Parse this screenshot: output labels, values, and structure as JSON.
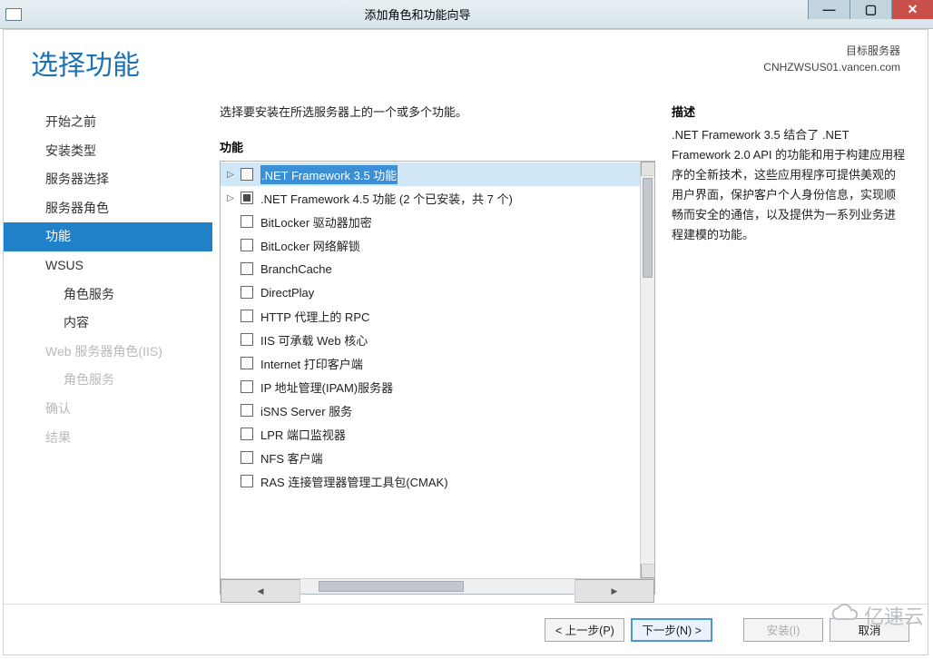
{
  "window": {
    "title": "添加角色和功能向导"
  },
  "header": {
    "title": "选择功能",
    "target_label": "目标服务器",
    "target_server": "CNHZWSUS01.vancen.com"
  },
  "sidebar": {
    "items": [
      {
        "label": "开始之前",
        "state": "normal"
      },
      {
        "label": "安装类型",
        "state": "normal"
      },
      {
        "label": "服务器选择",
        "state": "normal"
      },
      {
        "label": "服务器角色",
        "state": "normal"
      },
      {
        "label": "功能",
        "state": "selected"
      },
      {
        "label": "WSUS",
        "state": "normal"
      },
      {
        "label": "角色服务",
        "state": "normal",
        "indent": true
      },
      {
        "label": "内容",
        "state": "normal",
        "indent": true
      },
      {
        "label": "Web 服务器角色(IIS)",
        "state": "disabled"
      },
      {
        "label": "角色服务",
        "state": "disabled",
        "indent": true
      },
      {
        "label": "确认",
        "state": "disabled"
      },
      {
        "label": "结果",
        "state": "disabled"
      }
    ]
  },
  "main": {
    "instruction": "选择要安装在所选服务器上的一个或多个功能。",
    "features_label": "功能",
    "items": [
      {
        "expander": "right",
        "check": "unchecked",
        "label": ".NET Framework 3.5 功能",
        "selected": true
      },
      {
        "expander": "right",
        "check": "partial",
        "label": ".NET Framework 4.5 功能 (2 个已安装，共 7 个)"
      },
      {
        "expander": "none",
        "check": "unchecked",
        "label": "BitLocker 驱动器加密"
      },
      {
        "expander": "none",
        "check": "unchecked",
        "label": "BitLocker 网络解锁"
      },
      {
        "expander": "none",
        "check": "unchecked",
        "label": "BranchCache"
      },
      {
        "expander": "none",
        "check": "unchecked",
        "label": "DirectPlay"
      },
      {
        "expander": "none",
        "check": "unchecked",
        "label": "HTTP 代理上的 RPC"
      },
      {
        "expander": "none",
        "check": "unchecked",
        "label": "IIS 可承载 Web 核心"
      },
      {
        "expander": "none",
        "check": "unchecked",
        "label": "Internet 打印客户端"
      },
      {
        "expander": "none",
        "check": "unchecked",
        "label": "IP 地址管理(IPAM)服务器"
      },
      {
        "expander": "none",
        "check": "unchecked",
        "label": "iSNS Server 服务"
      },
      {
        "expander": "none",
        "check": "unchecked",
        "label": "LPR 端口监视器"
      },
      {
        "expander": "none",
        "check": "unchecked",
        "label": "NFS 客户端"
      },
      {
        "expander": "none",
        "check": "unchecked",
        "label": "RAS 连接管理器管理工具包(CMAK)"
      }
    ]
  },
  "desc": {
    "label": "描述",
    "text": ".NET Framework 3.5 结合了 .NET Framework 2.0 API 的功能和用于构建应用程序的全新技术，这些应用程序可提供美观的用户界面，保护客户个人身份信息，实现顺畅而安全的通信，以及提供为一系列业务进程建模的功能。"
  },
  "footer": {
    "prev": "< 上一步(P)",
    "next": "下一步(N) >",
    "install": "安装(I)",
    "cancel": "取消"
  },
  "watermark": "亿速云"
}
